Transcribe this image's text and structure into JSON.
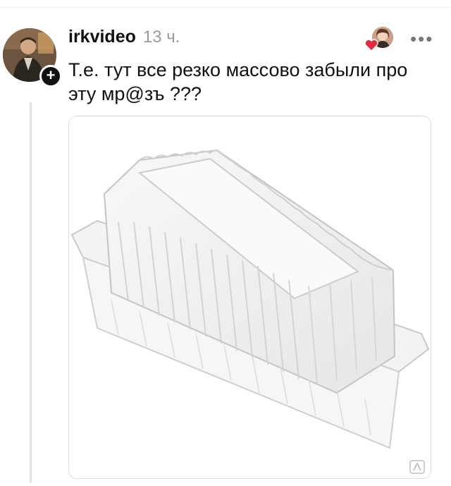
{
  "post": {
    "username": "irkvideo",
    "timestamp": "13 ч.",
    "text": "Т.е. тут все резко массово забыли про эту мр@зъ ???"
  },
  "icons": {
    "follow": "plus-icon",
    "like": "heart-icon",
    "more": "more-icon",
    "watermark": "watermark-logo-icon"
  },
  "colors": {
    "heart": "#e8283c",
    "text": "#111111",
    "muted": "#9a9a9a"
  },
  "media": {
    "content": "clear plastic food container"
  }
}
